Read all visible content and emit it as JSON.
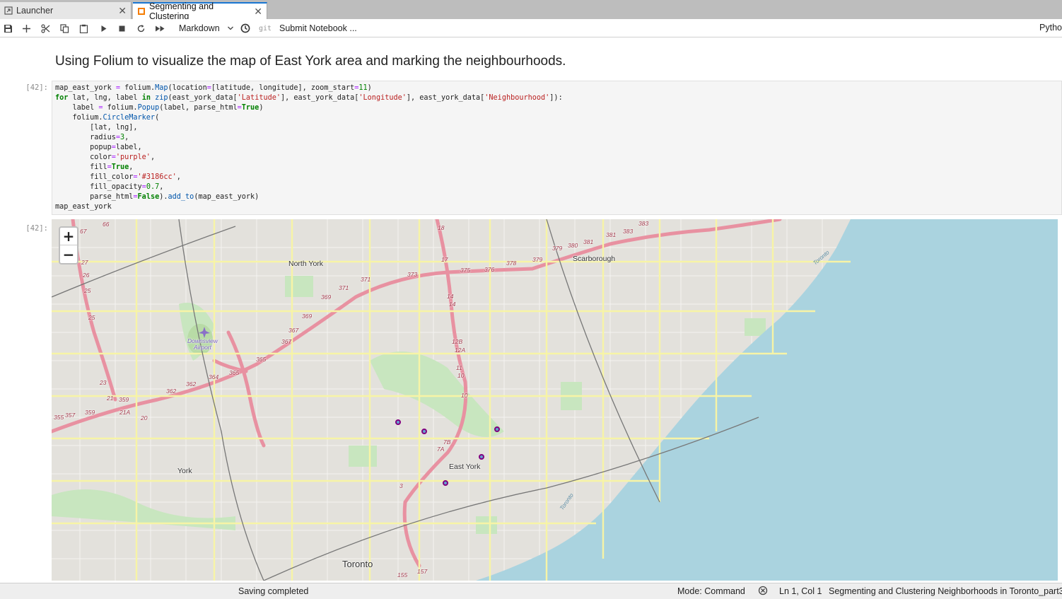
{
  "tabs": [
    {
      "label": "Launcher",
      "active": false,
      "icon": "launcher-icon"
    },
    {
      "label": "Segmenting and Clustering",
      "active": true,
      "icon": "notebook-icon"
    }
  ],
  "toolbar": {
    "cell_type": "Markdown",
    "git_label": "git",
    "submit_label": "Submit Notebook ...",
    "kernel": "Pytho"
  },
  "notebook": {
    "heading": "Using Folium to visualize the map of East York area and marking the neighbourhoods.",
    "code_prompt": "[42]:",
    "output_prompt": "[42]:",
    "code_lines": [
      "map_east_york = folium.Map(location=[latitude, longitude], zoom_start=11)",
      "for lat, lng, label in zip(east_york_data['Latitude'], east_york_data['Longitude'], east_york_data['Neighbourhood']):",
      "    label = folium.Popup(label, parse_html=True)",
      "    folium.CircleMarker(",
      "        [lat, lng],",
      "        radius=3,",
      "        popup=label,",
      "        color='purple',",
      "        fill=True,",
      "        fill_color='#3186cc',",
      "        fill_opacity=0.7,",
      "        parse_html=False).add_to(map_east_york)",
      "map_east_york"
    ]
  },
  "map": {
    "zoom_in": "+",
    "zoom_out": "−",
    "place_labels": [
      "North York",
      "Scarborough",
      "East York",
      "York",
      "Toronto"
    ],
    "airport_label": [
      "Downsview",
      "Airport"
    ],
    "route_labels": [
      "66",
      "67",
      "27",
      "26",
      "25",
      "25",
      "23",
      "21",
      "359",
      "359",
      "357",
      "355",
      "21A",
      "20",
      "362",
      "362",
      "364",
      "365",
      "365",
      "367",
      "367",
      "369",
      "369",
      "371",
      "371",
      "373",
      "375",
      "376",
      "378",
      "379",
      "379",
      "380",
      "381",
      "381",
      "383",
      "383",
      "18",
      "17",
      "14",
      "14",
      "12B",
      "12A",
      "11",
      "10",
      "10",
      "7B",
      "7A",
      "3",
      "155",
      "157"
    ],
    "water_labels": [
      "Toronto",
      "Toronto"
    ],
    "marker_color": "#800080",
    "marker_fill": "#3186cc",
    "water_color": "#aad3df",
    "land_color": "#e5e3df"
  },
  "status": {
    "saving": "Saving completed",
    "mode": "Mode: Command",
    "position": "Ln 1, Col 1",
    "file": "Segmenting and Clustering Neighborhoods in Toronto_part3."
  }
}
